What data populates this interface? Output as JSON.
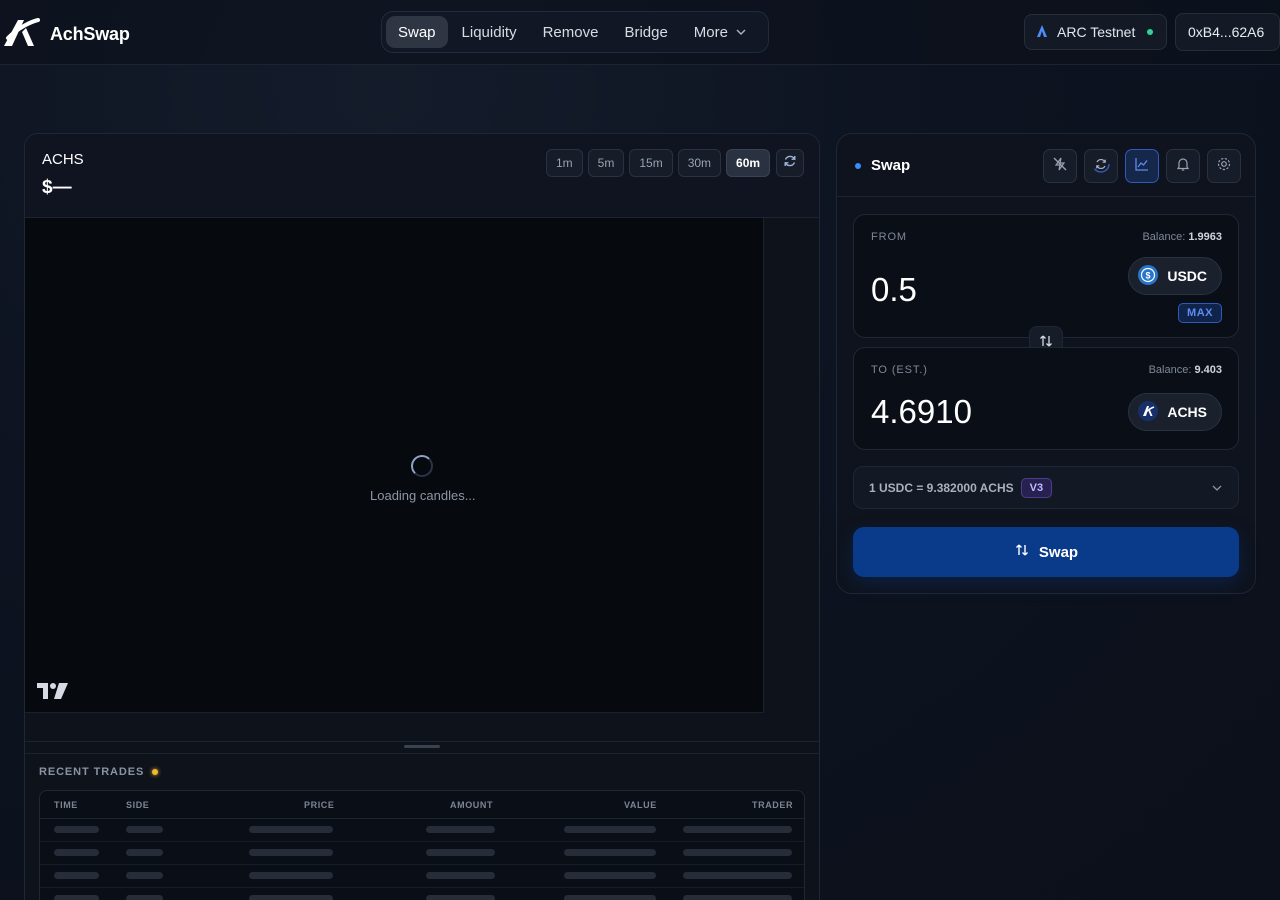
{
  "header": {
    "app_name": "AchSwap",
    "nav": [
      {
        "label": "Swap",
        "active": true
      },
      {
        "label": "Liquidity"
      },
      {
        "label": "Remove"
      },
      {
        "label": "Bridge"
      },
      {
        "label": "More",
        "dropdown": true
      }
    ],
    "network": "ARC Testnet",
    "network_status_color": "#2fd39a",
    "wallet": "0xB4...62A6"
  },
  "chart": {
    "symbol": "ACHS",
    "price": "$—",
    "timeframes": [
      "1m",
      "5m",
      "15m",
      "30m",
      "60m"
    ],
    "active_timeframe": "60m",
    "loading_text": "Loading candles..."
  },
  "trades": {
    "title": "RECENT TRADES",
    "columns": [
      "TIME",
      "SIDE",
      "PRICE",
      "AMOUNT",
      "VALUE",
      "TRADER"
    ]
  },
  "swap": {
    "title": "Swap",
    "from": {
      "label": "FROM",
      "balance_label": "Balance:",
      "balance": "1.9963",
      "amount": "0.5",
      "token": "USDC",
      "max_label": "MAX"
    },
    "to": {
      "label": "TO (EST.)",
      "balance_label": "Balance:",
      "balance": "9.403",
      "amount": "4.6910",
      "token": "ACHS"
    },
    "rate": "1 USDC = 9.382000 ACHS",
    "version": "V3",
    "button_label": "Swap",
    "accent_color": "#0a3a8a"
  }
}
